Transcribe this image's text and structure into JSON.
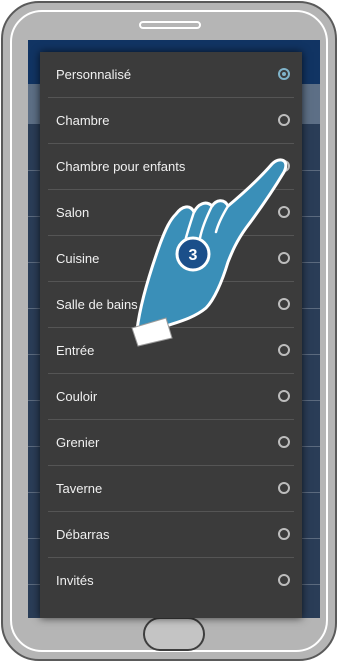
{
  "options": [
    {
      "label": "Personnalisé",
      "selected": true
    },
    {
      "label": "Chambre",
      "selected": false
    },
    {
      "label": "Chambre pour enfants",
      "selected": false
    },
    {
      "label": "Salon",
      "selected": false
    },
    {
      "label": "Cuisine",
      "selected": false
    },
    {
      "label": "Salle de bains",
      "selected": false
    },
    {
      "label": "Entrée",
      "selected": false
    },
    {
      "label": "Couloir",
      "selected": false
    },
    {
      "label": "Grenier",
      "selected": false
    },
    {
      "label": "Taverne",
      "selected": false
    },
    {
      "label": "Débarras",
      "selected": false
    },
    {
      "label": "Invités",
      "selected": false
    }
  ],
  "step_badge": "3",
  "colors": {
    "hand": "#3a8fb8",
    "badge": "#1b4f8a",
    "selected_radio": "#7fb3c9"
  }
}
